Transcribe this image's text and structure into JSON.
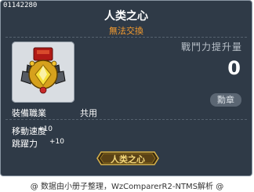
{
  "item": {
    "id": "01142280",
    "name": "人类之心",
    "trade_status": "無法交換",
    "colors": {
      "trade_status": "#f39b2f",
      "background": "#2f3a47"
    }
  },
  "stats_panel": {
    "power_label": "戰鬥力提升量",
    "power_value": "0",
    "medal_button_label": "勳章"
  },
  "job": {
    "label": "裝備職業",
    "value": "共用"
  },
  "bonuses": [
    {
      "label": "移動速度",
      "value": "+10"
    },
    {
      "label": "跳躍力",
      "value": "+10"
    }
  ],
  "badge": {
    "text": "人类之心"
  },
  "footer": {
    "text": "@ 数据由小册子整理，WzComparerR2-NTMS解析 @"
  },
  "icons": {
    "item_icon": "medal-icon"
  }
}
